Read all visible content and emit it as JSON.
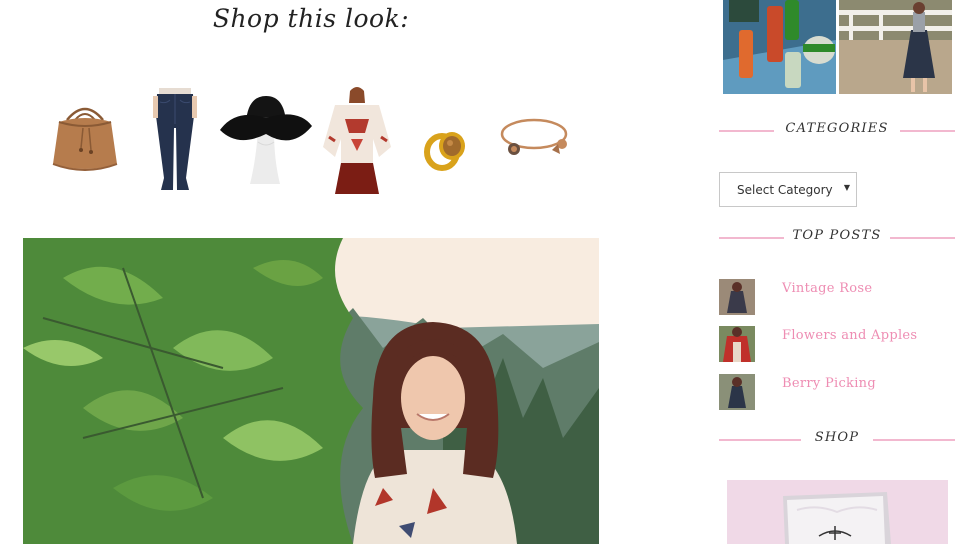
{
  "post": {
    "shop_heading": "Shop this look:"
  },
  "products": [
    {
      "icon": "bucket-bag-icon"
    },
    {
      "icon": "flare-jeans-icon"
    },
    {
      "icon": "floppy-hat-icon"
    },
    {
      "icon": "printed-tunic-icon"
    },
    {
      "icon": "gold-ring-icon"
    },
    {
      "icon": "charm-bangle-icon"
    }
  ],
  "sidebar": {
    "categories": {
      "title": "CATEGORIES",
      "select_value": "Select Category"
    },
    "top_posts": {
      "title": "TOP POSTS",
      "items": [
        {
          "title": "Vintage Rose"
        },
        {
          "title": "Flowers and Apples"
        },
        {
          "title": "Berry Picking"
        }
      ]
    },
    "shop": {
      "title": "SHOP"
    }
  },
  "colors": {
    "accent_pink": "#ee8db3",
    "divider_pink": "#f2b8cf",
    "shop_banner_bg": "#f0d9e7"
  }
}
